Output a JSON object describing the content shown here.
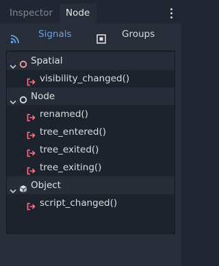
{
  "tabs": {
    "inspector": "Inspector",
    "node": "Node"
  },
  "subtabs": {
    "signals": "Signals",
    "groups": "Groups"
  },
  "sections": [
    {
      "label": "Spatial",
      "icon": "circle-outline-red",
      "signals": [
        "visibility_changed()"
      ]
    },
    {
      "label": "Node",
      "icon": "circle-outline-white",
      "signals": [
        "renamed()",
        "tree_entered()",
        "tree_exited()",
        "tree_exiting()"
      ]
    },
    {
      "label": "Object",
      "icon": "cube-icon",
      "signals": [
        "script_changed()"
      ]
    }
  ],
  "colors": {
    "background": "#212732",
    "panel": "#272e3a",
    "tree": "#1d232d",
    "accent": "#6da2e6",
    "signal_icon": "#ff7085"
  }
}
